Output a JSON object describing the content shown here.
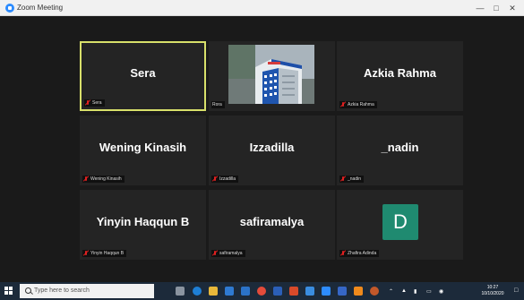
{
  "window": {
    "title": "Zoom Meeting",
    "controls": [
      "minimize",
      "maximize",
      "close"
    ]
  },
  "tiles": [
    {
      "display": "Sera",
      "footer": "Sera",
      "muted": true,
      "active": true
    },
    {
      "display": "",
      "footer": "Rora",
      "muted": false,
      "video": "building-video-feed"
    },
    {
      "display": "Azkia Rahma",
      "footer": "Azkia Rahma",
      "muted": true
    },
    {
      "display": "Wening Kinasih",
      "footer": "Wening Kinasih",
      "muted": true
    },
    {
      "display": "Izzadilla",
      "footer": "Izzadilla",
      "muted": true
    },
    {
      "display": "_nadin",
      "footer": "_nadin",
      "muted": true
    },
    {
      "display": "Yinyin Haqqun B",
      "footer": "Yinyin Haqqun B",
      "muted": true
    },
    {
      "display": "safiramalya",
      "footer": "safiramalya",
      "muted": true
    },
    {
      "display": "",
      "footer": "Zhafira Adinda",
      "muted": true,
      "avatar_letter": "D",
      "avatar_color": "#1f8a70"
    }
  ],
  "taskbar": {
    "search_placeholder": "Type here to search",
    "time": "10:27",
    "date": "10/10/2020",
    "apps": [
      "task-view-icon",
      "edge-icon",
      "file-explorer-icon",
      "store-icon",
      "mail-icon",
      "chrome-icon",
      "word-icon",
      "powerpoint-icon",
      "photos-icon",
      "zoom-icon",
      "camera-icon",
      "vlc-icon",
      "firefox-icon"
    ]
  },
  "colors": {
    "active_border": "#d8e06a",
    "muted_icon": "#e02020",
    "avatar_bg": "#1f8a70",
    "taskbar_bg": "#1c2a3a"
  }
}
